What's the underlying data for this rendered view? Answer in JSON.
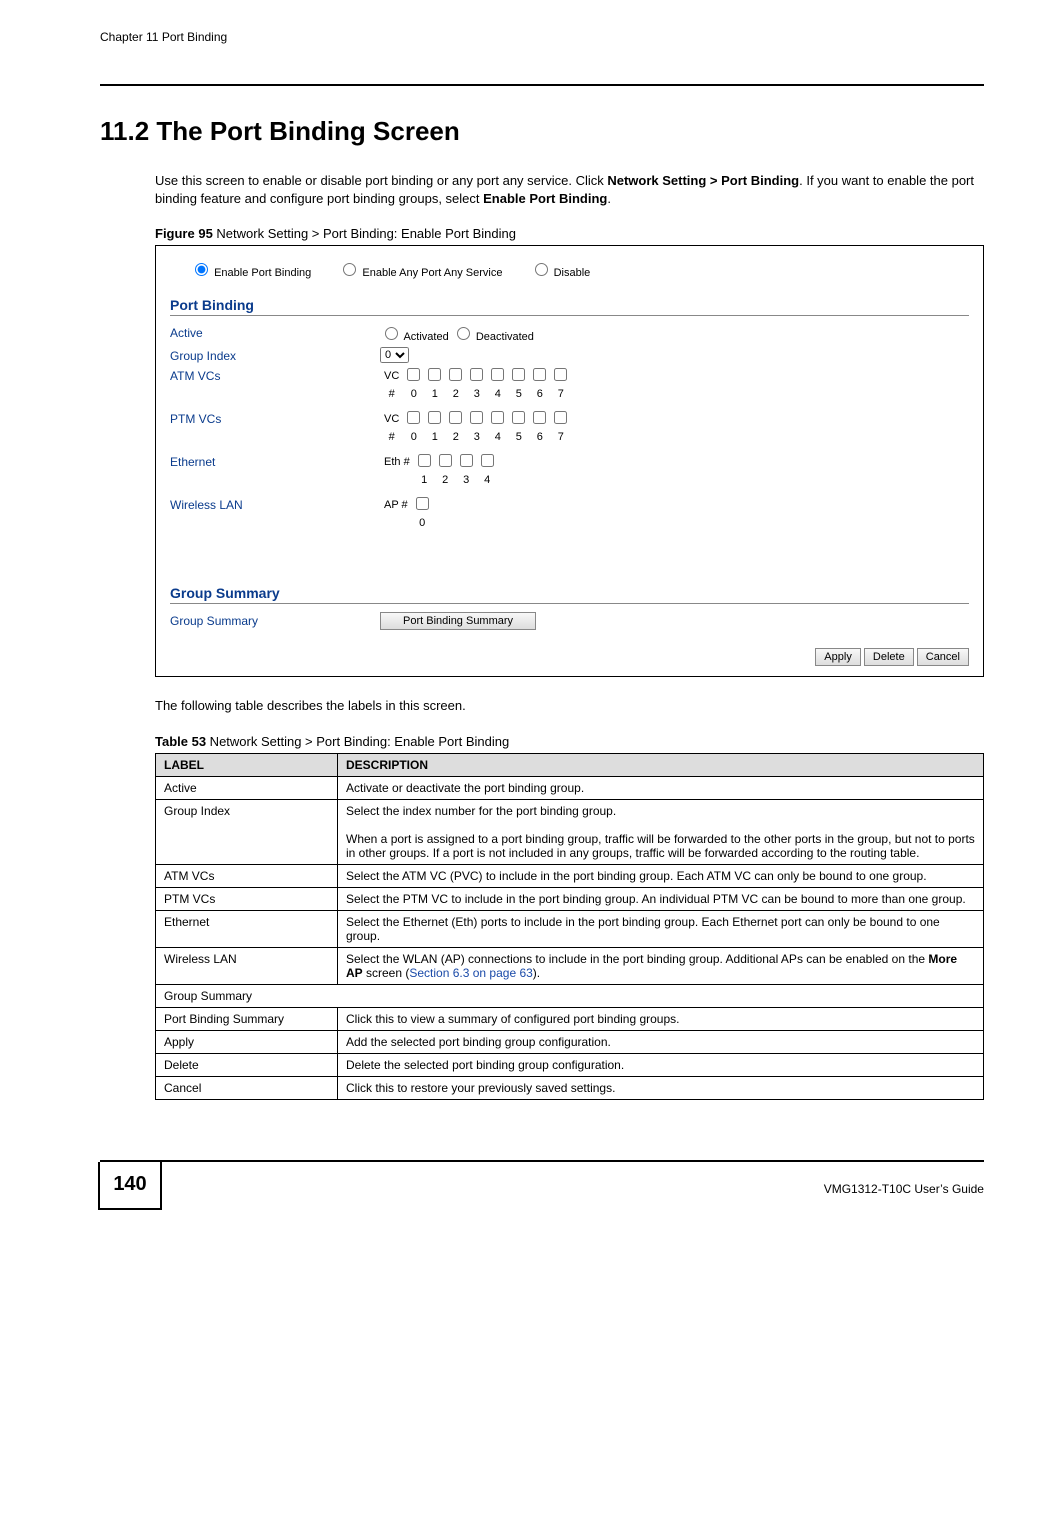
{
  "header": {
    "chapter": "Chapter 11 Port Binding"
  },
  "section": {
    "number_title": "11.2  The Port Binding Screen",
    "intro_pre": "Use this screen to enable or disable port binding or any port any service. Click ",
    "intro_bold1": "Network Setting > Port Binding",
    "intro_mid": ". If you want to enable the port binding feature and configure port binding groups, select ",
    "intro_bold2": "Enable Port Binding",
    "intro_post": "."
  },
  "figure": {
    "caption_label": "Figure 95",
    "caption_text": "   Network Setting > Port Binding: Enable Port Binding",
    "top_radios": {
      "opt1": "Enable Port Binding",
      "opt2": "Enable Any Port Any Service",
      "opt3": "Disable",
      "selected": "Enable Port Binding"
    },
    "section1_title": "Port Binding",
    "active": {
      "label": "Active",
      "opt1": "Activated",
      "opt2": "Deactivated"
    },
    "group_index": {
      "label": "Group Index",
      "value": "0"
    },
    "atm": {
      "label": "ATM VCs",
      "row1_prefix": "VC",
      "row2_prefix": "#",
      "cols": [
        "0",
        "1",
        "2",
        "3",
        "4",
        "5",
        "6",
        "7"
      ]
    },
    "ptm": {
      "label": "PTM VCs",
      "row1_prefix": "VC",
      "row2_prefix": "#",
      "cols": [
        "0",
        "1",
        "2",
        "3",
        "4",
        "5",
        "6",
        "7"
      ]
    },
    "eth": {
      "label": "Ethernet",
      "row1_prefix": "Eth  #",
      "cols": [
        "1",
        "2",
        "3",
        "4"
      ]
    },
    "wlan": {
      "label": "Wireless LAN",
      "row1_prefix": "AP  #",
      "cols": [
        "0"
      ]
    },
    "section2_title": "Group Summary",
    "summary": {
      "label": "Group Summary",
      "button": "Port Binding Summary"
    },
    "buttons": {
      "apply": "Apply",
      "delete": "Delete",
      "cancel": "Cancel"
    }
  },
  "after_figure_text": "The following table describes the labels in this screen.",
  "table": {
    "caption_label": "Table 53",
    "caption_text": "   Network Setting > Port Binding: Enable Port Binding",
    "headers": {
      "c1": "LABEL",
      "c2": "DESCRIPTION"
    },
    "rows": [
      {
        "label": "Active",
        "desc": "Activate or deactivate the port binding group."
      },
      {
        "label": "Group Index",
        "desc_line1": "Select the index number for the port binding group.",
        "desc_line2": "When a port is assigned to a port binding group, traffic will be forwarded to the other ports in the group, but not to ports in other groups. If a port is not included in any groups, traffic will be forwarded according to the routing table."
      },
      {
        "label": "ATM VCs",
        "desc": "Select the ATM VC (PVC) to include in the port binding group. Each ATM VC can only be bound to one group."
      },
      {
        "label": "PTM VCs",
        "desc": "Select the PTM VC to include in the port binding group. An individual PTM VC can be bound to more than one group."
      },
      {
        "label": "Ethernet",
        "desc": "Select the Ethernet (Eth) ports to include in the port binding group. Each Ethernet port can only be bound to one group."
      },
      {
        "label": "Wireless LAN",
        "desc_pre": "Select the WLAN (AP) connections to include in the port binding group. Additional APs can be enabled on the ",
        "desc_bold": "More AP",
        "desc_mid": " screen (",
        "desc_link": "Section 6.3 on page 63",
        "desc_post": ")."
      },
      {
        "label": "Group Summary"
      },
      {
        "label": "Port Binding Summary",
        "desc": "Click this to view a summary of configured port binding groups."
      },
      {
        "label": "Apply",
        "desc": "Add the selected port binding group configuration."
      },
      {
        "label": "Delete",
        "desc": "Delete the selected port binding group configuration."
      },
      {
        "label": "Cancel",
        "desc": "Click this to restore your previously saved settings."
      }
    ]
  },
  "footer": {
    "page_number": "140",
    "guide": "VMG1312-T10C User’s Guide"
  }
}
